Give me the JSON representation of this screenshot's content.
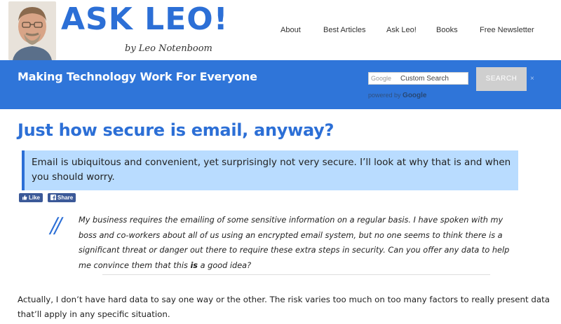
{
  "header": {
    "logo_title": "ASK LEO!",
    "logo_subtitle": "by Leo Notenboom",
    "nav": [
      {
        "label": "About"
      },
      {
        "label": "Best Articles"
      },
      {
        "label": "Ask Leo!"
      },
      {
        "label": "Books"
      },
      {
        "label": "Free Newsletter"
      }
    ]
  },
  "banner": {
    "tagline": "Making Technology Work For Everyone",
    "search": {
      "brand": "Google",
      "placeholder": "Custom Search",
      "powered_by": "powered by",
      "powered_brand": "Google",
      "button": "SEARCH",
      "clear": "×"
    }
  },
  "article": {
    "title": "Just how secure is email, anyway?",
    "summary": "Email is ubiquitous and convenient, yet surprisingly not very secure. I’ll look at why that is and when you should worry.",
    "social": {
      "like": "Like",
      "share": "Share"
    },
    "quote_mark": "//",
    "question_pre": "My business requires the emailing of some sensitive information on a regular basis. I have spoken with my boss and co-workers about all of us using an encrypted email system, but no one seems to think there is a significant threat or danger out there to require these extra steps in security. Can you offer any data to help me convince them that this ",
    "question_bold": "is",
    "question_post": " a good idea?",
    "answer": "Actually, I don’t have hard data to say one way or the other. The risk varies too much on too many factors to really present data that’ll apply in any specific situation."
  },
  "colors": {
    "brand_blue": "#2c6fd6",
    "banner_blue": "#2f75d9",
    "summary_bg": "#b9dcff",
    "facebook_blue": "#3b5998"
  }
}
